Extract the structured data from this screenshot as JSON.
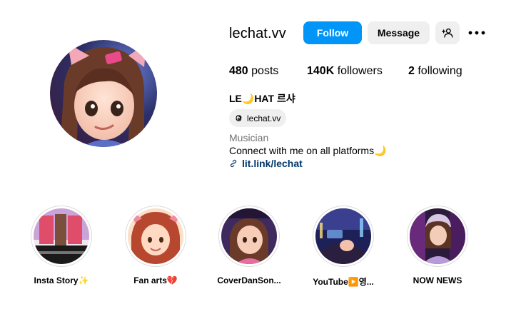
{
  "profile": {
    "username": "lechat.vv",
    "full_name": "LE🌙HAT 르샤",
    "category": "Musician",
    "bio": "Connect with me on all platforms🌙",
    "link_text": "lit.link/lechat",
    "threads_handle": "lechat.vv"
  },
  "actions": {
    "follow_label": "Follow",
    "message_label": "Message"
  },
  "stats": {
    "posts_count": "480",
    "posts_label": "posts",
    "followers_count": "140K",
    "followers_label": "followers",
    "following_count": "2",
    "following_label": "following"
  },
  "highlights": [
    {
      "label": "Insta Story✨"
    },
    {
      "label": "Fan arts💔"
    },
    {
      "label": "CoverDanSon..."
    },
    {
      "label": "YouTube▶️영..."
    },
    {
      "label": "NOW NEWS"
    }
  ],
  "colors": {
    "follow_button": "#0095f6",
    "secondary_button": "#efefef",
    "link": "#00376b",
    "muted_text": "#737373"
  },
  "icons": [
    "threads-icon",
    "add-user-icon",
    "more-options-icon",
    "link-chain-icon"
  ]
}
